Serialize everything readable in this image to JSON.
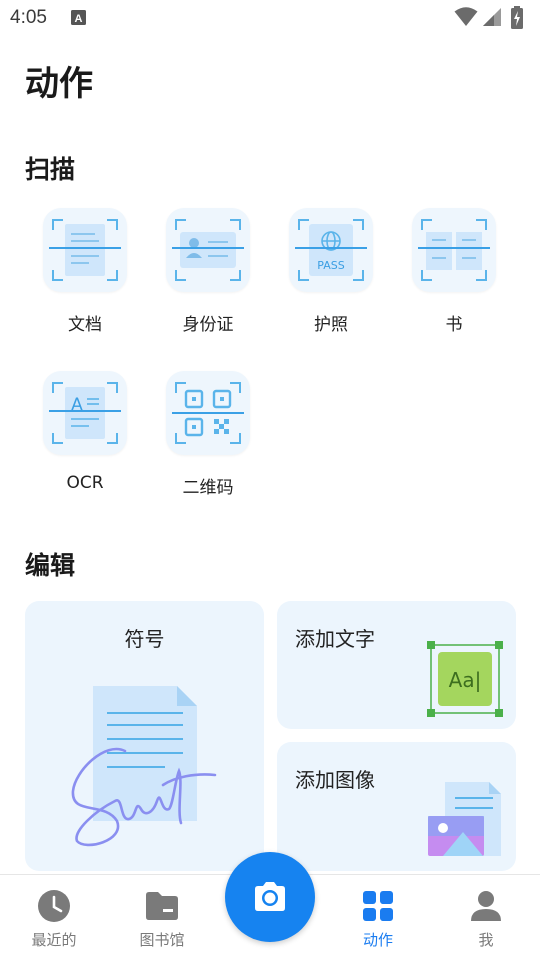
{
  "status_bar": {
    "time": "4:05",
    "notification_icon": "a-icon",
    "icons": [
      "wifi-icon",
      "signal-icon",
      "battery-charging-icon"
    ]
  },
  "page": {
    "title": "动作"
  },
  "scan": {
    "title": "扫描",
    "items": [
      {
        "label": "文档",
        "icon": "document-scan-icon"
      },
      {
        "label": "身份证",
        "icon": "id-card-scan-icon"
      },
      {
        "label": "护照",
        "icon": "passport-scan-icon",
        "icon_text": "PASS"
      },
      {
        "label": "书",
        "icon": "book-scan-icon"
      },
      {
        "label": "OCR",
        "icon": "ocr-scan-icon",
        "icon_text": "A"
      },
      {
        "label": "二维码",
        "icon": "qr-code-scan-icon"
      }
    ]
  },
  "edit": {
    "title": "编辑",
    "cards": [
      {
        "label": "符号",
        "icon": "signature-illustration"
      },
      {
        "label": "添加文字",
        "icon": "add-text-illustration",
        "icon_text": "Aa|"
      },
      {
        "label": "添加图像",
        "icon": "add-image-illustration"
      }
    ]
  },
  "bottom_nav": {
    "items": [
      {
        "label": "最近的",
        "icon": "clock-icon",
        "active": false
      },
      {
        "label": "图书馆",
        "icon": "folder-icon",
        "active": false
      },
      {
        "label": "动作",
        "icon": "grid-icon",
        "active": true
      },
      {
        "label": "我",
        "icon": "person-icon",
        "active": false
      }
    ],
    "fab_icon": "camera-icon"
  },
  "colors": {
    "accent": "#1a7cf0",
    "fab": "#1683f0",
    "tile_bg": "#eef6fd",
    "card_bg": "#ecf5fd",
    "icon_light_blue": "#cfe6fb",
    "scan_line": "#3aa0e6",
    "text_highlight_green": "#6cc24a",
    "nav_inactive": "#7a7a7a"
  }
}
